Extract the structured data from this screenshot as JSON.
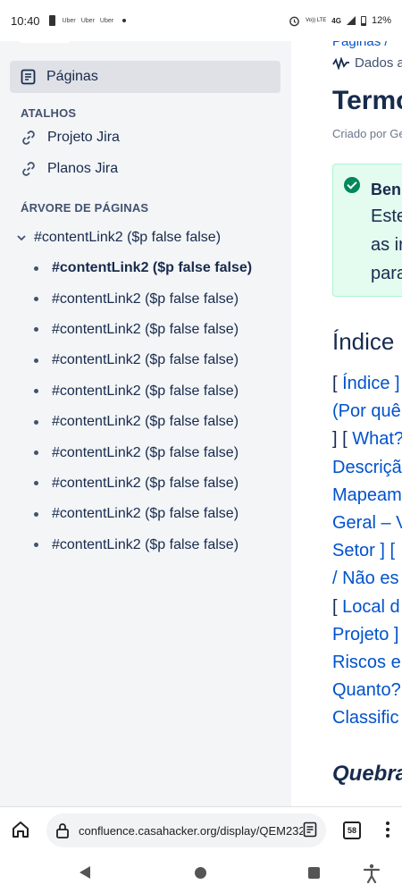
{
  "status_bar": {
    "time": "10:40",
    "notifications": [
      "Uber",
      "Uber",
      "Uber"
    ],
    "volte": "Vo)) LTE",
    "network": "4G",
    "battery": "12%"
  },
  "sidebar": {
    "pages_label": "Páginas",
    "shortcuts_title": "ATALHOS",
    "shortcuts": [
      {
        "label": "Projeto Jira"
      },
      {
        "label": "Planos Jira"
      }
    ],
    "tree_title": "ÁRVORE DE PÁGINAS",
    "tree_root": "#contentLink2 ($p false false)",
    "tree_items": [
      {
        "label": "#contentLink2 ($p false false)",
        "current": true
      },
      {
        "label": "#contentLink2 ($p false false)"
      },
      {
        "label": "#contentLink2 ($p false false)"
      },
      {
        "label": "#contentLink2 ($p false false)"
      },
      {
        "label": "#contentLink2 ($p false false)"
      },
      {
        "label": "#contentLink2 ($p false false)"
      },
      {
        "label": "#contentLink2 ($p false false)"
      },
      {
        "label": "#contentLink2 ($p false false)"
      },
      {
        "label": "#contentLink2 ($p false false)"
      },
      {
        "label": "#contentLink2 ($p false false)"
      }
    ]
  },
  "main": {
    "breadcrumb": "Páginas /",
    "analytics": "Dados a",
    "title": "Termo",
    "byline": "Criado por Ge",
    "panel": {
      "title": "Ben",
      "lines": [
        "Este",
        "as ir",
        "para"
      ]
    },
    "toc_heading": "Índice",
    "toc_lines": [
      {
        "pre": "[ ",
        "link": "Índice ]"
      },
      {
        "pre": "",
        "link": "(Por quê"
      },
      {
        "pre": "] [ ",
        "link": "What?"
      },
      {
        "pre": "",
        "link": "Descriçã"
      },
      {
        "pre": "",
        "link": "Mapeam"
      },
      {
        "pre": "",
        "link": "Geral – V"
      },
      {
        "pre": "",
        "link": "Setor ] [",
        "post_dark": true
      },
      {
        "pre": "",
        "link": "/ Não es"
      },
      {
        "pre": "[ ",
        "link": "Local d"
      },
      {
        "pre": "",
        "link": "Projeto ]"
      },
      {
        "pre": "",
        "link": "Riscos e"
      },
      {
        "pre": "",
        "link": "Quanto?"
      },
      {
        "pre": "",
        "link": "Classific"
      }
    ],
    "section_heading": "Quebra"
  },
  "browser": {
    "url": "confluence.casahacker.org/display/QEM2324",
    "tab_count": "58"
  }
}
